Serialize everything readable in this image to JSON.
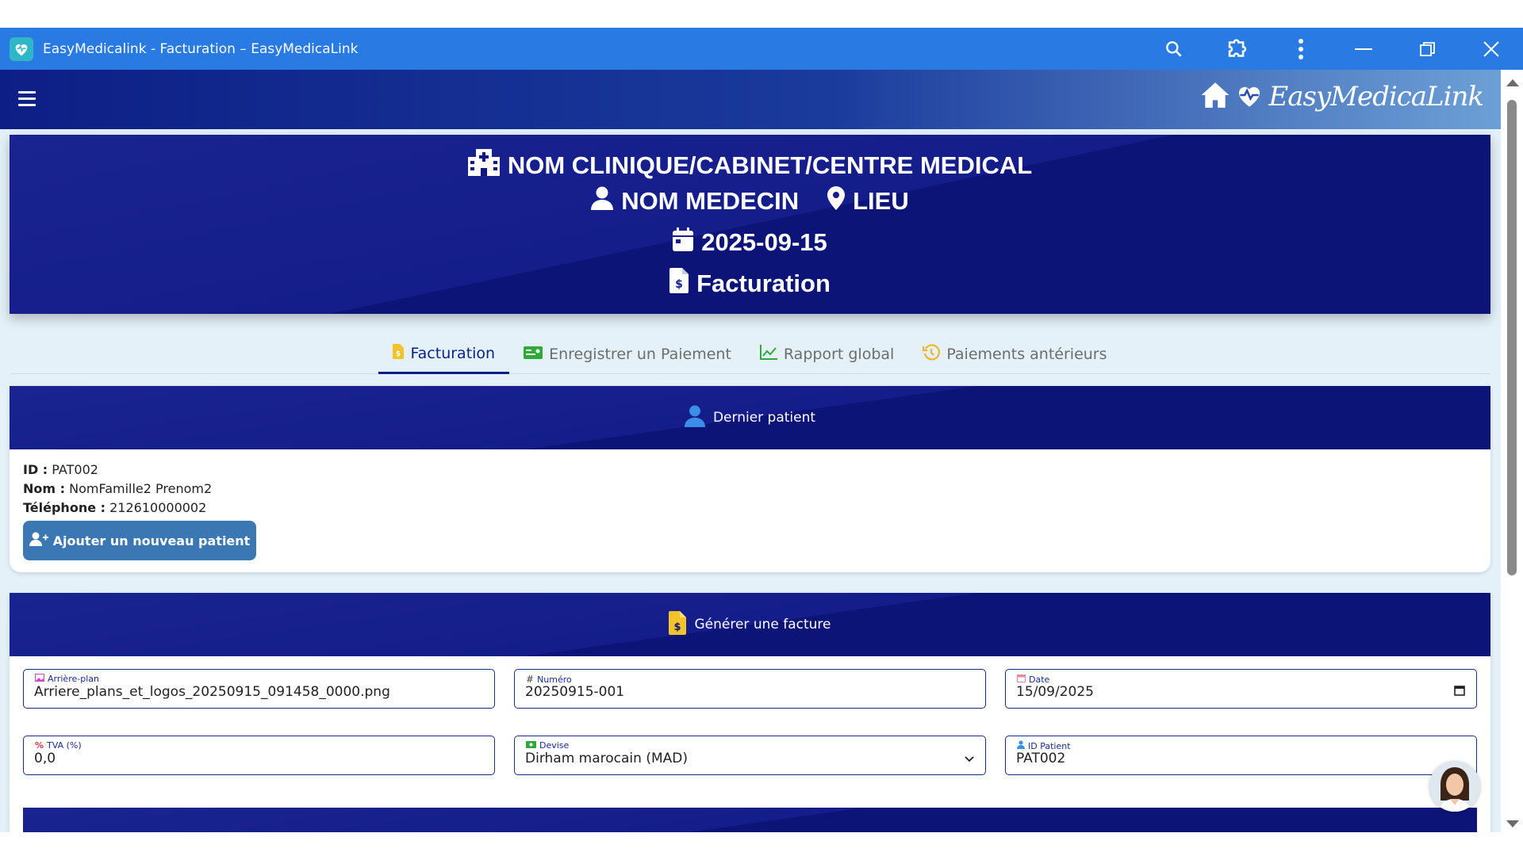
{
  "window": {
    "title": "EasyMedicalink - Facturation – EasyMedicaLink"
  },
  "brand": {
    "name": "EasyMedicaLink"
  },
  "header": {
    "clinic": "NOM CLINIQUE/CABINET/CENTRE MEDICAL",
    "doctor": "NOM MEDECIN",
    "location": "LIEU",
    "date": "2025-09-15",
    "section": "Facturation"
  },
  "tabs": [
    {
      "label": "Facturation",
      "icon": "invoice-icon",
      "active": true
    },
    {
      "label": "Enregistrer un Paiement",
      "icon": "money-bill-icon",
      "active": false
    },
    {
      "label": "Rapport global",
      "icon": "chart-line-icon",
      "active": false
    },
    {
      "label": "Paiements antérieurs",
      "icon": "history-icon",
      "active": false
    }
  ],
  "last_patient": {
    "title": "Dernier patient",
    "id_label": "ID :",
    "id_value": "PAT002",
    "name_label": "Nom :",
    "name_value": "NomFamille2 Prenom2",
    "phone_label": "Téléphone :",
    "phone_value": "212610000002",
    "add_button": "Ajouter un nouveau patient"
  },
  "invoice": {
    "title": "Générer une facture",
    "fields": {
      "background": {
        "label": "Arrière-plan",
        "value": "Arriere_plans_et_logos_20250915_091458_0000.png"
      },
      "number": {
        "label": "Numéro",
        "value": "20250915-001"
      },
      "date": {
        "label": "Date",
        "value": "15/09/2025"
      },
      "vat": {
        "label": "TVA (%)",
        "value": "0,0"
      },
      "currency": {
        "label": "Devise",
        "value": "Dirham marocain (MAD)"
      },
      "patient_id": {
        "label": "ID Patient",
        "value": "PAT002"
      }
    }
  },
  "colors": {
    "titlebar": "#2a7ae4",
    "navy": "#0d1f86",
    "accent_button": "#3b77b2",
    "page_bg": "#e4f1f8"
  }
}
